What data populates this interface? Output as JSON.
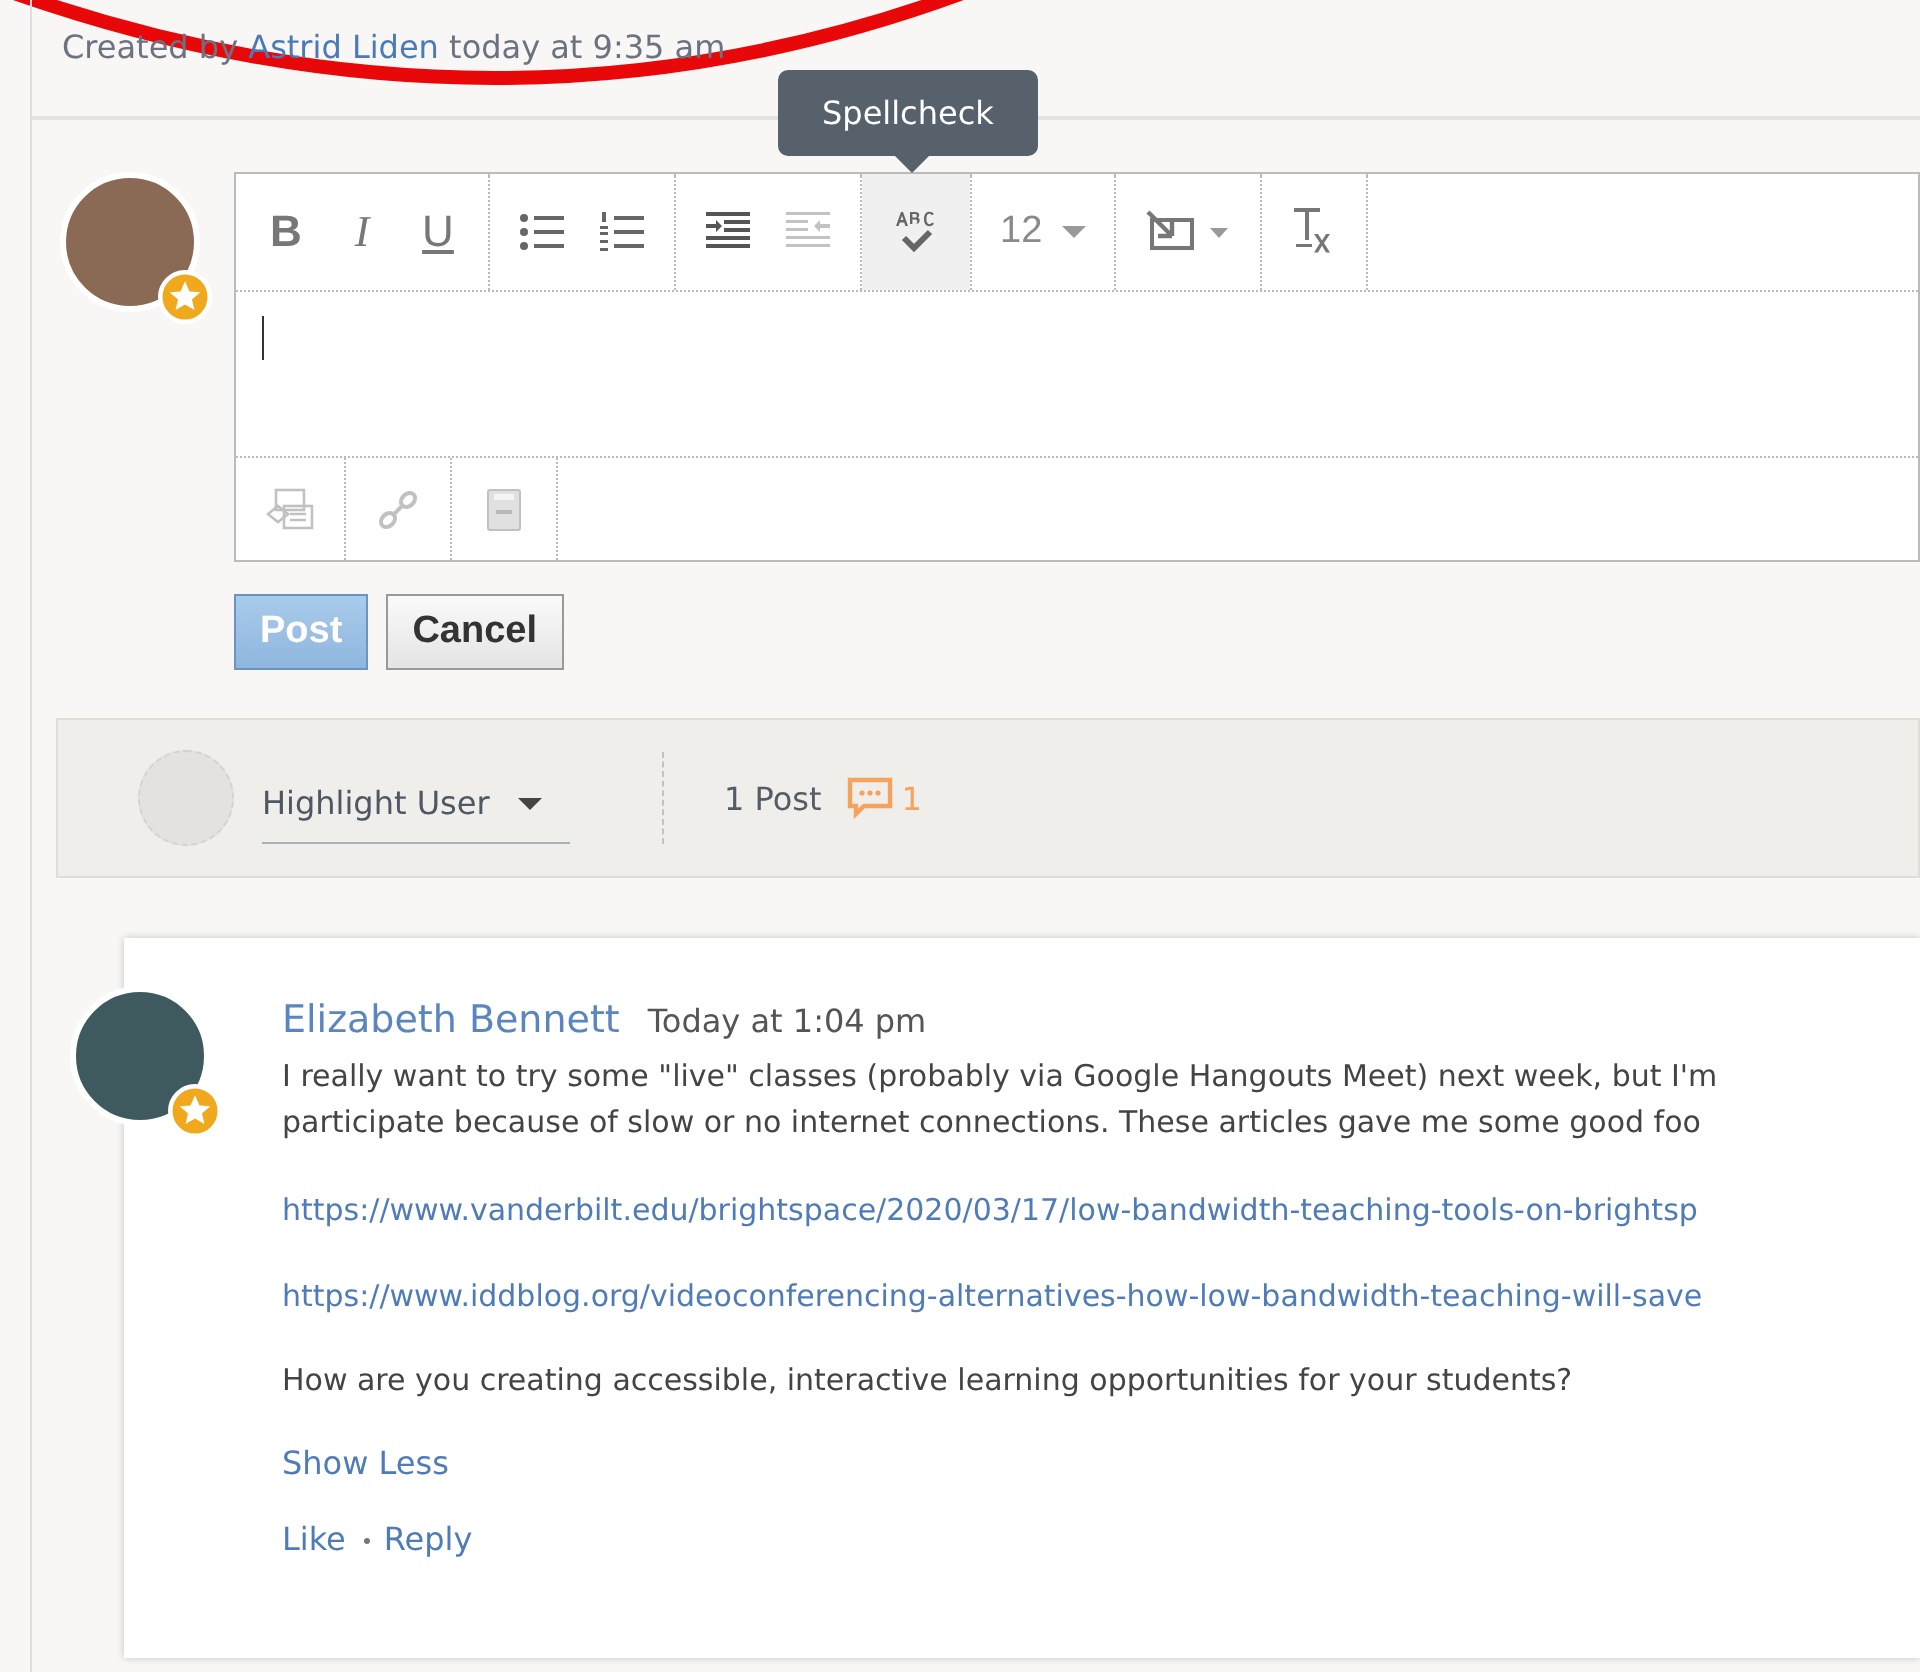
{
  "topic": {
    "created_prefix": "Created by",
    "author": "Astrid Liden",
    "created_suffix": "today at 9:35 am"
  },
  "editor": {
    "format_buttons": [
      {
        "label": "B"
      },
      {
        "label": "I"
      },
      {
        "label": "U"
      }
    ],
    "outdent_disabled": true,
    "spellcheck_selected": true,
    "tooltip": "Spellcheck",
    "font_size": "12",
    "attachments_disabled": true
  },
  "buttons": [
    {
      "label": "Post",
      "kind": "primary",
      "disabled": true
    },
    {
      "label": "Cancel",
      "kind": "secondary",
      "disabled": false
    }
  ],
  "filter_bar": {
    "highlight_user": "Highlight User",
    "post_count": "1 Post",
    "reply_count": "1"
  },
  "post": {
    "author": "Elizabeth Bennett",
    "time": "Today at 1:04 pm",
    "lines": [
      "I really want to try some \"live\" classes (probably via Google Hangouts Meet) next week, but I'm",
      "participate because of slow or no internet connections.  These articles gave me some good foo"
    ],
    "links": [
      "https://www.vanderbilt.edu/brightspace/2020/03/17/low-bandwidth-teaching-tools-on-brightsp",
      "https://www.iddblog.org/videoconferencing-alternatives-how-low-bandwidth-teaching-will-save"
    ],
    "question": "How are you creating accessible, interactive learning opportunities for your students?",
    "show_less": "Show Less",
    "actions": [
      "Like",
      "Reply"
    ]
  }
}
